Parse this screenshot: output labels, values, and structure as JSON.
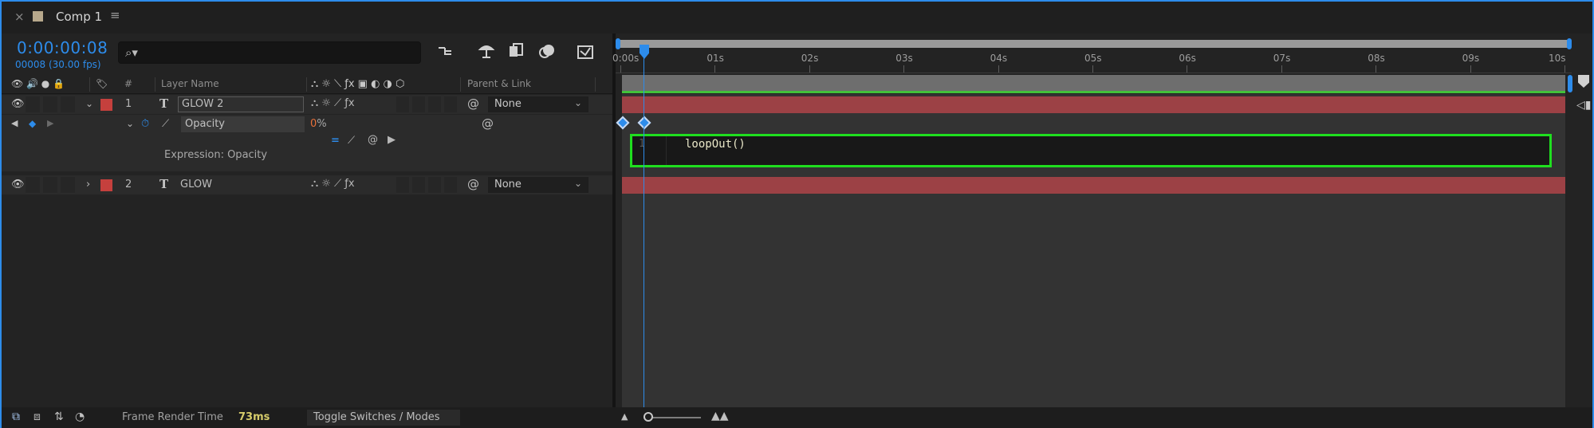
{
  "tab": {
    "close": "×",
    "title": "Comp 1",
    "menu": "≡"
  },
  "header": {
    "timecode": "0:00:00:08",
    "frame_info": "00008 (30.00 fps)",
    "search_placeholder": ""
  },
  "columns": {
    "number": "#",
    "layer_name": "Layer Name",
    "parent_link": "Parent & Link"
  },
  "layers": [
    {
      "number": "1",
      "type": "T",
      "name": "GLOW 2",
      "parent": "None",
      "color": "#c5403d"
    },
    {
      "number": "2",
      "type": "T",
      "name": "GLOW",
      "parent": "None",
      "color": "#c5403d"
    }
  ],
  "property": {
    "name": "Opacity",
    "value": "0",
    "unit": "%",
    "expression_label": "Expression: Opacity"
  },
  "expression": {
    "line_number": "1",
    "code": "loopOut()"
  },
  "timeline": {
    "ticks": [
      "0:00s",
      "01s",
      "02s",
      "03s",
      "04s",
      "05s",
      "06s",
      "07s",
      "08s",
      "09s",
      "10s"
    ]
  },
  "footer": {
    "render_label": "Frame Render Time",
    "render_value": "73ms",
    "toggle_label": "Toggle Switches / Modes"
  },
  "colors": {
    "accent": "#2d8ceb",
    "highlight": "#1fdf1f",
    "layer_bar": "#9c4145"
  }
}
